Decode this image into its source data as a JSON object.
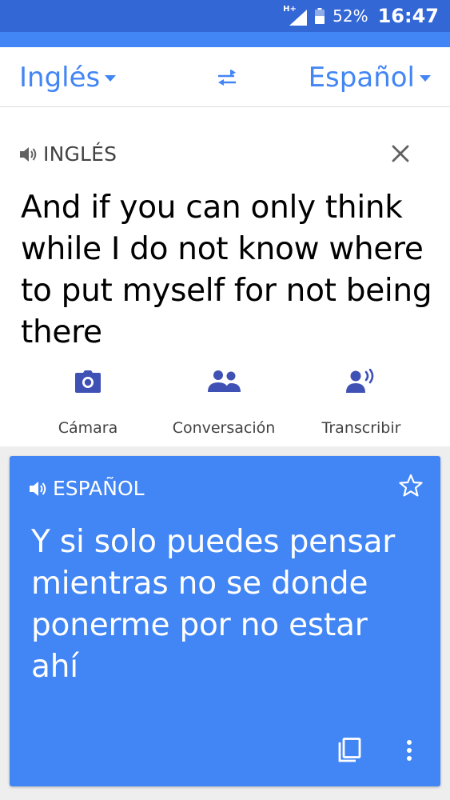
{
  "status_bar": {
    "network": "H+",
    "battery_percent": "52%",
    "time": "16:47"
  },
  "language_bar": {
    "source_language": "Inglés",
    "target_language": "Español",
    "swap_icon": "swap-arrows-icon"
  },
  "source": {
    "language_label": "INGLÉS",
    "text": "And if you can only think while I do not know where to put myself for not being there",
    "tools": [
      {
        "label": "Cámara",
        "icon": "camera-icon"
      },
      {
        "label": "Conversación",
        "icon": "people-icon"
      },
      {
        "label": "Transcribir",
        "icon": "voice-person-icon"
      }
    ]
  },
  "translation": {
    "language_label": "ESPAÑOL",
    "text": "Y si solo puedes pensar mientras no se donde ponerme por no estar ahí"
  },
  "colors": {
    "status_bar": "#3367d6",
    "accent": "#4285f4",
    "icon_tool": "#3f51b5"
  }
}
